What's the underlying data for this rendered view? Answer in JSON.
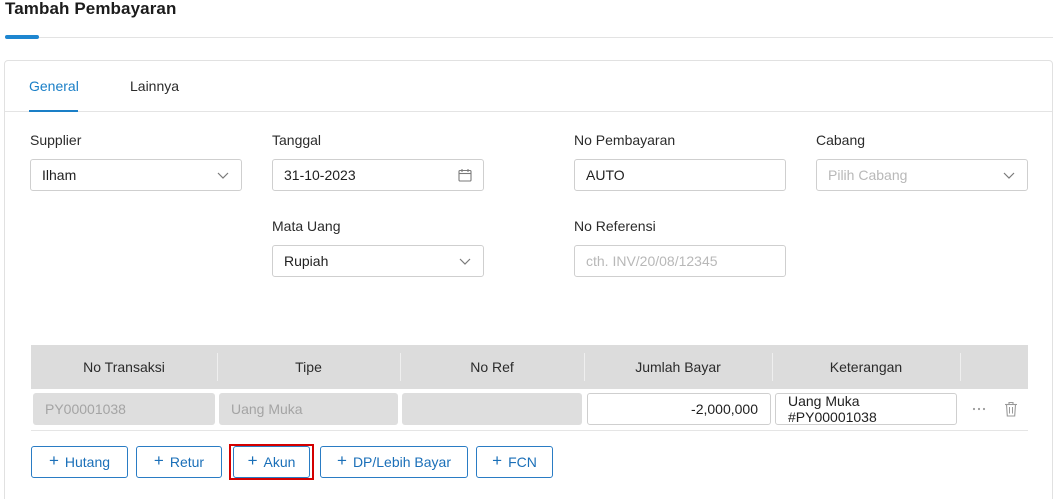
{
  "page": {
    "title": "Tambah Pembayaran"
  },
  "tabs": [
    {
      "label": "General",
      "active": true
    },
    {
      "label": "Lainnya",
      "active": false
    }
  ],
  "form": {
    "supplier": {
      "label": "Supplier",
      "value": "Ilham",
      "icon": "chevron-down-icon"
    },
    "tanggal": {
      "label": "Tanggal",
      "value": "31-10-2023",
      "icon": "calendar-icon"
    },
    "no_pembayaran": {
      "label": "No Pembayaran",
      "value": "AUTO"
    },
    "cabang": {
      "label": "Cabang",
      "placeholder": "Pilih Cabang",
      "icon": "chevron-down-icon"
    },
    "mata_uang": {
      "label": "Mata Uang",
      "value": "Rupiah",
      "icon": "chevron-down-icon"
    },
    "no_referensi": {
      "label": "No Referensi",
      "placeholder": "cth. INV/20/08/12345"
    }
  },
  "table": {
    "headers": [
      "No Transaksi",
      "Tipe",
      "No Ref",
      "Jumlah Bayar",
      "Keterangan"
    ],
    "rows": [
      {
        "no_transaksi": "PY00001038",
        "tipe": "Uang Muka",
        "no_ref": "",
        "jumlah_bayar": "-2,000,000",
        "keterangan": "Uang Muka #PY00001038"
      }
    ]
  },
  "actions": {
    "hutang": "Hutang",
    "retur": "Retur",
    "akun": "Akun",
    "dp": "DP/Lebih Bayar",
    "fcn": "FCN"
  },
  "colors": {
    "accent": "#1a7fc7",
    "highlight": "#d40000",
    "header_bg": "#dcdcdc"
  }
}
